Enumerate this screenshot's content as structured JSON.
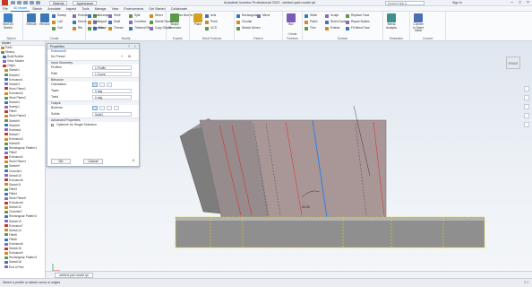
{
  "titlebar": {
    "material": "Material",
    "appearance": "Appearance",
    "window_title": "Autodesk Inventor Professional 2023 - welded-part-model.ipt",
    "search_placeholder": "Search Help & Commands...",
    "user": "Sign In"
  },
  "menu": {
    "tabs": [
      "File",
      "3D Model",
      "Sketch",
      "Annotate",
      "Inspect",
      "Tools",
      "Manage",
      "View",
      "Environments",
      "Get Started",
      "Collaborate"
    ],
    "active_index": 1
  },
  "ribbon": {
    "groups": [
      {
        "label": "Sketch",
        "big": [
          {
            "label": "Start 2D Sketch",
            "color": "#3c7fc2"
          }
        ]
      },
      {
        "label": "Create",
        "big": [
          {
            "label": "Extrude",
            "color": "#3a76b8"
          },
          {
            "label": "Revolve",
            "color": "#3a76b8"
          }
        ],
        "small": [
          "Sweep",
          "Loft",
          "Coil",
          "Emboss",
          "Derive",
          "Rib",
          "Unwrap",
          "Import",
          "Decal"
        ]
      },
      {
        "label": "Modify",
        "small": [
          "Hole",
          "Fillet",
          "Chamfer",
          "Shell",
          "Draft",
          "Thread",
          "Split",
          "Combine",
          "Thicken/Offset",
          "Direct",
          "Delete Face",
          "Copy Object",
          "Move Bodies"
        ]
      },
      {
        "label": "Explore",
        "big": [
          {
            "label": "Shape Generator",
            "color": "#5a9a4a"
          }
        ]
      },
      {
        "label": "Work Features",
        "big": [
          {
            "label": "Plane",
            "color": "#d6a21e"
          }
        ],
        "small": [
          "Axis",
          "Point",
          "UCS"
        ]
      },
      {
        "label": "Pattern",
        "small": [
          "Rectangular",
          "Circular",
          "Sketch Driven",
          "Mirror"
        ]
      },
      {
        "label": "Create Freeform",
        "big": [
          {
            "label": "Box",
            "color": "#7a5bb5"
          }
        ]
      },
      {
        "label": "Surface",
        "small": [
          "Stitch",
          "Patch",
          "Trim",
          "Sculpt",
          "Ruled Surface",
          "Extend",
          "Replace Face",
          "Repair Bodies",
          "Fit Mesh Face"
        ]
      },
      {
        "label": "Simulation",
        "big": [
          {
            "label": "Stress Analysis",
            "color": "#3f8f8f"
          }
        ]
      },
      {
        "label": "Convert",
        "big": [
          {
            "label": "Convert to Sheet Metal",
            "color": "#4a6fb0"
          }
        ]
      }
    ]
  },
  "browser": {
    "header": "Model",
    "items": [
      "Part1",
      "History",
      "Solid Bodies",
      "View: Master",
      "Origin",
      "Sketch1",
      "Sketch2",
      "Extrusion1",
      "Sketch3",
      "Work Plane1",
      "Extrusion2",
      "Work Plane2",
      "Sketch4",
      "Sweep1",
      "Fillet1",
      "Work Plane3",
      "Sketch5",
      "Sketch6",
      "Emboss1",
      "Sketch7",
      "Extrusion3",
      "Sketch8",
      "Rectangular Pattern1",
      "Fillet2",
      "Extrusion4",
      "Work Plane4",
      "Sketch9",
      "Chamfer1",
      "Sketch10",
      "Extrusion5",
      "Sketch11",
      "Fillet3",
      "Fillet4",
      "Work Plane5",
      "Extrusion6",
      "Sketch12",
      "Chamfer2",
      "Rectangular Pattern2",
      "Sketch13",
      "Extrusion7",
      "Sketch14",
      "Fillet5",
      "Fillet6",
      "Extrusion8",
      "Sketch15",
      "Extrusion9",
      "Rectangular Pattern3",
      "Sketch16",
      "End of Part"
    ]
  },
  "prop_panel": {
    "title": "Properties",
    "feature": "Extrusion5",
    "preset": "No Preset",
    "section_input": "Input Geometry",
    "profile_label": "Profiles",
    "profile_value": "1 Profile",
    "path_label": "Path",
    "path_value": "1 Curve",
    "section_behavior": "Behavior",
    "orientation_label": "Orientation",
    "taper_label": "Taper",
    "taper_value": "0 deg",
    "twist_label": "Twist",
    "twist_value": "0 deg",
    "section_output": "Output",
    "boolean_label": "Boolean",
    "solids_label": "Solids",
    "solids_value": "Solid1",
    "section_advanced": "Advanced Properties",
    "optimize_label": "Optimize for Single Selection",
    "ok": "OK",
    "cancel": "Cancel"
  },
  "viewcube": {
    "label": "FRONT"
  },
  "doc_tab": {
    "label": "welded-part-model.ipt"
  },
  "status": {
    "text": "Select a profile or sketch curve or edges",
    "right": "2   1"
  },
  "colors": {
    "accent": "#0d6fb8",
    "body": "#8a8a8a",
    "edge_red": "#d6392f",
    "edge_blue": "#2e7fe0",
    "edge_yellow": "#e6d21a"
  }
}
